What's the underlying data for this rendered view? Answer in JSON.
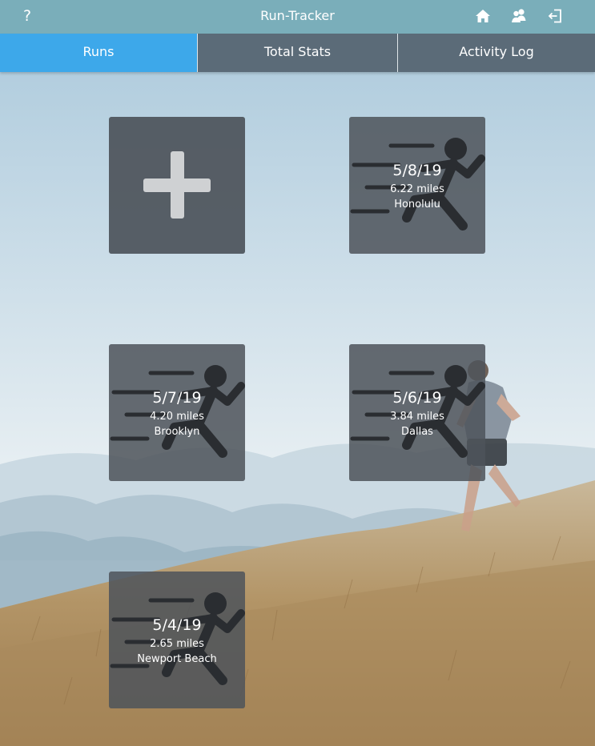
{
  "header": {
    "help_label": "?",
    "title": "Run-Tracker",
    "icons": [
      "home-icon",
      "friends-icon",
      "logout-icon"
    ]
  },
  "tabs": [
    {
      "label": "Runs",
      "active": true
    },
    {
      "label": "Total Stats",
      "active": false
    },
    {
      "label": "Activity Log",
      "active": false
    }
  ],
  "add_card": {
    "icon": "plus-icon"
  },
  "runs": [
    {
      "date": "5/8/19",
      "distance": "6.22 miles",
      "location": "Honolulu"
    },
    {
      "date": "5/7/19",
      "distance": "4.20 miles",
      "location": "Brooklyn"
    },
    {
      "date": "5/6/19",
      "distance": "3.84 miles",
      "location": "Dallas"
    },
    {
      "date": "5/4/19",
      "distance": "2.65 miles",
      "location": "Newport Beach"
    }
  ],
  "colors": {
    "header_bg": "#7aaeba",
    "tab_bar_bg": "#5b6b78",
    "tab_active_bg": "#3da8ea",
    "card_bg": "#4e545b",
    "runner_icon": "#2a2d31"
  }
}
